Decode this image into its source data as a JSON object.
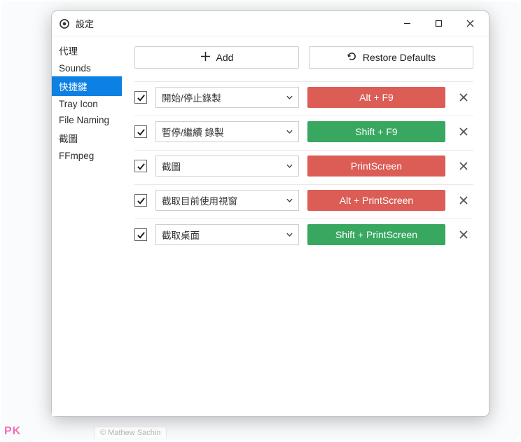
{
  "window": {
    "title": "設定"
  },
  "sidebar": {
    "items": [
      {
        "label": "代理",
        "key": "proxy",
        "active": false
      },
      {
        "label": "Sounds",
        "key": "sounds",
        "active": false
      },
      {
        "label": "快捷鍵",
        "key": "hotkeys",
        "active": true
      },
      {
        "label": "Tray Icon",
        "key": "trayicon",
        "active": false
      },
      {
        "label": "File Naming",
        "key": "filenaming",
        "active": false
      },
      {
        "label": "截圖",
        "key": "screenshot",
        "active": false
      },
      {
        "label": "FFmpeg",
        "key": "ffmpeg",
        "active": false
      }
    ]
  },
  "toolbar": {
    "add_label": "Add",
    "restore_label": "Restore Defaults"
  },
  "hotkeys": [
    {
      "enabled": true,
      "action": "開始/停止錄製",
      "key": "Alt + F9",
      "color": "red"
    },
    {
      "enabled": true,
      "action": "暫停/繼續 錄製",
      "key": "Shift + F9",
      "color": "green"
    },
    {
      "enabled": true,
      "action": "截圖",
      "key": "PrintScreen",
      "color": "red"
    },
    {
      "enabled": true,
      "action": "截取目前使用視窗",
      "key": "Alt + PrintScreen",
      "color": "red"
    },
    {
      "enabled": true,
      "action": "截取桌面",
      "key": "Shift + PrintScreen",
      "color": "green"
    }
  ],
  "footer": {
    "copyright": "© Mathew Sachin"
  },
  "watermark": "PK"
}
